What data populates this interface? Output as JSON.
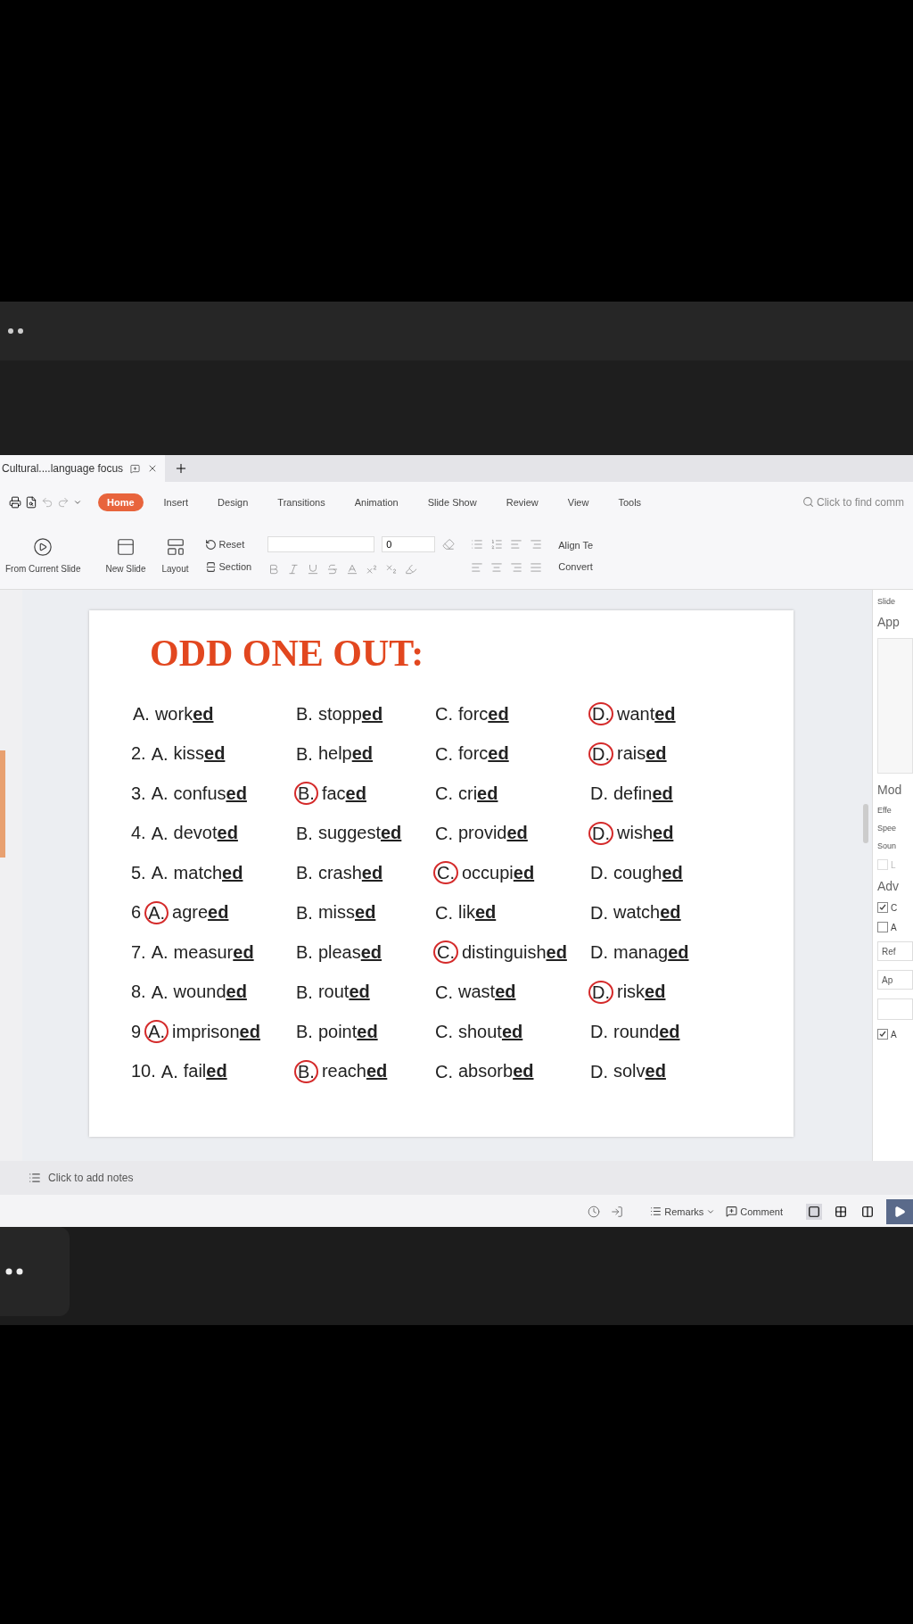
{
  "document_tab": {
    "title": "Cultural....language focus"
  },
  "menu": [
    {
      "label": "Home",
      "selected": true
    },
    {
      "label": "Insert",
      "selected": false
    },
    {
      "label": "Design",
      "selected": false
    },
    {
      "label": "Transitions",
      "selected": false
    },
    {
      "label": "Animation",
      "selected": false
    },
    {
      "label": "Slide Show",
      "selected": false
    },
    {
      "label": "Review",
      "selected": false
    },
    {
      "label": "View",
      "selected": false
    },
    {
      "label": "Tools",
      "selected": false
    }
  ],
  "search": {
    "placeholder": "Click to find comm"
  },
  "ribbon": {
    "from_current_slide": "From Current Slide",
    "new_slide": "New Slide",
    "layout": "Layout",
    "reset": "Reset",
    "section": "Section",
    "font_size": "0",
    "align_text": "Align Te",
    "convert": "Convert"
  },
  "slide": {
    "title": "ODD ONE OUT:",
    "rows": [
      {
        "number": "",
        "options": [
          {
            "letter": "A.",
            "word": "work**ed**",
            "circled": false
          },
          {
            "letter": "B.",
            "word": "stopp**ed**",
            "circled": false
          },
          {
            "letter": "C.",
            "word": "forc**ed**",
            "circled": false
          },
          {
            "letter": "D.",
            "word": "want**ed**",
            "circled": true
          }
        ]
      },
      {
        "number": "2.",
        "options": [
          {
            "letter": "A.",
            "word": "kiss**ed**",
            "circled": false
          },
          {
            "letter": "B.",
            "word": "help**ed**",
            "circled": false
          },
          {
            "letter": "C.",
            "word": "forc**ed**",
            "circled": false
          },
          {
            "letter": "D.",
            "word": "rais**ed**",
            "circled": true
          }
        ]
      },
      {
        "number": "3.",
        "options": [
          {
            "letter": "A.",
            "word": "confus**ed**",
            "circled": false
          },
          {
            "letter": "B.",
            "word": "fac**ed**",
            "circled": true
          },
          {
            "letter": "C.",
            "word": "cri**ed**",
            "circled": false
          },
          {
            "letter": "D.",
            "word": "defin**ed**",
            "circled": false
          }
        ]
      },
      {
        "number": "4.",
        "options": [
          {
            "letter": "A.",
            "word": "devot**ed**",
            "circled": false
          },
          {
            "letter": "B.",
            "word": "suggest**ed**",
            "circled": false
          },
          {
            "letter": "C.",
            "word": "provid**ed**",
            "circled": false
          },
          {
            "letter": "D.",
            "word": "wish**ed**",
            "circled": true
          }
        ]
      },
      {
        "number": "5.",
        "options": [
          {
            "letter": "A.",
            "word": "match**ed**",
            "circled": false
          },
          {
            "letter": "B.",
            "word": "crash**ed**",
            "circled": false
          },
          {
            "letter": "C.",
            "word": "occupi**ed**",
            "circled": true
          },
          {
            "letter": "D.",
            "word": "cough**ed**",
            "circled": false
          }
        ]
      },
      {
        "number": "6",
        "options": [
          {
            "letter": "A.",
            "word": "agre**ed**",
            "circled": true
          },
          {
            "letter": "B.",
            "word": "miss**ed**",
            "circled": false
          },
          {
            "letter": "C.",
            "word": "lik**ed**",
            "circled": false
          },
          {
            "letter": "D.",
            "word": "watch**ed**",
            "circled": false
          }
        ]
      },
      {
        "number": "7.",
        "options": [
          {
            "letter": "A.",
            "word": "measur**ed**",
            "circled": false
          },
          {
            "letter": "B.",
            "word": "pleas**ed**",
            "circled": false
          },
          {
            "letter": "C.",
            "word": "distinguish**ed**",
            "circled": true
          },
          {
            "letter": "D.",
            "word": "manag**ed**",
            "circled": false
          }
        ]
      },
      {
        "number": "8.",
        "options": [
          {
            "letter": "A.",
            "word": "wound**ed**",
            "circled": false
          },
          {
            "letter": "B.",
            "word": "rout**ed**",
            "circled": false
          },
          {
            "letter": "C.",
            "word": "wast**ed**",
            "circled": false
          },
          {
            "letter": "D.",
            "word": "risk**ed**",
            "circled": true
          }
        ]
      },
      {
        "number": "9",
        "options": [
          {
            "letter": "A.",
            "word": "imprison**ed**",
            "circled": true
          },
          {
            "letter": "B.",
            "word": "point**ed**",
            "circled": false
          },
          {
            "letter": "C.",
            "word": "shout**ed**",
            "circled": false
          },
          {
            "letter": "D.",
            "word": "round**ed**",
            "circled": false
          }
        ]
      },
      {
        "number": "10.",
        "options": [
          {
            "letter": "A.",
            "word": "fail**ed**",
            "circled": false
          },
          {
            "letter": "B.",
            "word": "reach**ed**",
            "circled": true
          },
          {
            "letter": "C.",
            "word": "absorb**ed**",
            "circled": false
          },
          {
            "letter": "D.",
            "word": "solv**ed**",
            "circled": false
          }
        ]
      }
    ]
  },
  "side_panel": [
    {
      "kind": "caption",
      "text": "Slide"
    },
    {
      "kind": "heading",
      "text": "App"
    },
    {
      "kind": "thumbnail"
    },
    {
      "kind": "heading",
      "text": "Mod"
    },
    {
      "kind": "caption",
      "text": "Effe"
    },
    {
      "kind": "caption",
      "text": "Spee"
    },
    {
      "kind": "caption",
      "text": "Soun"
    },
    {
      "kind": "checkbox",
      "text": "L",
      "checked": false,
      "disabled": true
    },
    {
      "kind": "heading",
      "text": "Adv"
    },
    {
      "kind": "checkbox",
      "text": "C",
      "checked": true,
      "disabled": false
    },
    {
      "kind": "checkbox",
      "text": "A",
      "checked": false,
      "disabled": false
    },
    {
      "kind": "button",
      "text": "Ref"
    },
    {
      "kind": "button",
      "text": "Ap"
    },
    {
      "kind": "field"
    },
    {
      "kind": "checkbox",
      "text": "A",
      "checked": true,
      "disabled": false
    }
  ],
  "notes": {
    "placeholder": "Click to add notes"
  },
  "status_bar": {
    "remarks": "Remarks",
    "comment": "Comment"
  }
}
